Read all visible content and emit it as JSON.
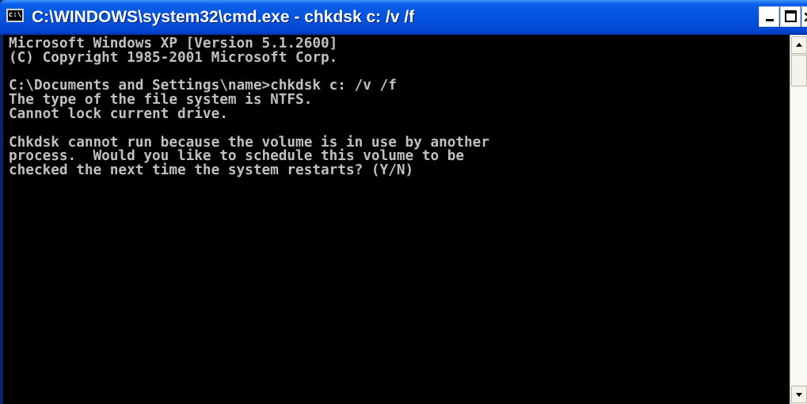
{
  "window": {
    "title": "C:\\WINDOWS\\system32\\cmd.exe - chkdsk c: /v /f",
    "icon_text": "c:\\",
    "title_icon": "cmd-icon",
    "controls": {
      "minimize_icon": "minimize-icon",
      "maximize_icon": "maximize-icon",
      "close_label": "×"
    }
  },
  "console": {
    "lines": [
      "Microsoft Windows XP [Version 5.1.2600]",
      "(C) Copyright 1985-2001 Microsoft Corp.",
      "",
      "C:\\Documents and Settings\\name>chkdsk c: /v /f",
      "The type of the file system is NTFS.",
      "Cannot lock current drive.",
      "",
      "Chkdsk cannot run because the volume is in use by another",
      "process.  Would you like to schedule this volume to be",
      "checked the next time the system restarts? (Y/N)"
    ],
    "colors": {
      "background": "#000000",
      "foreground": "#c0c0c0"
    }
  },
  "scrollbar": {
    "up_icon": "scroll-up-arrow-icon",
    "down_icon": "scroll-down-arrow-icon"
  }
}
